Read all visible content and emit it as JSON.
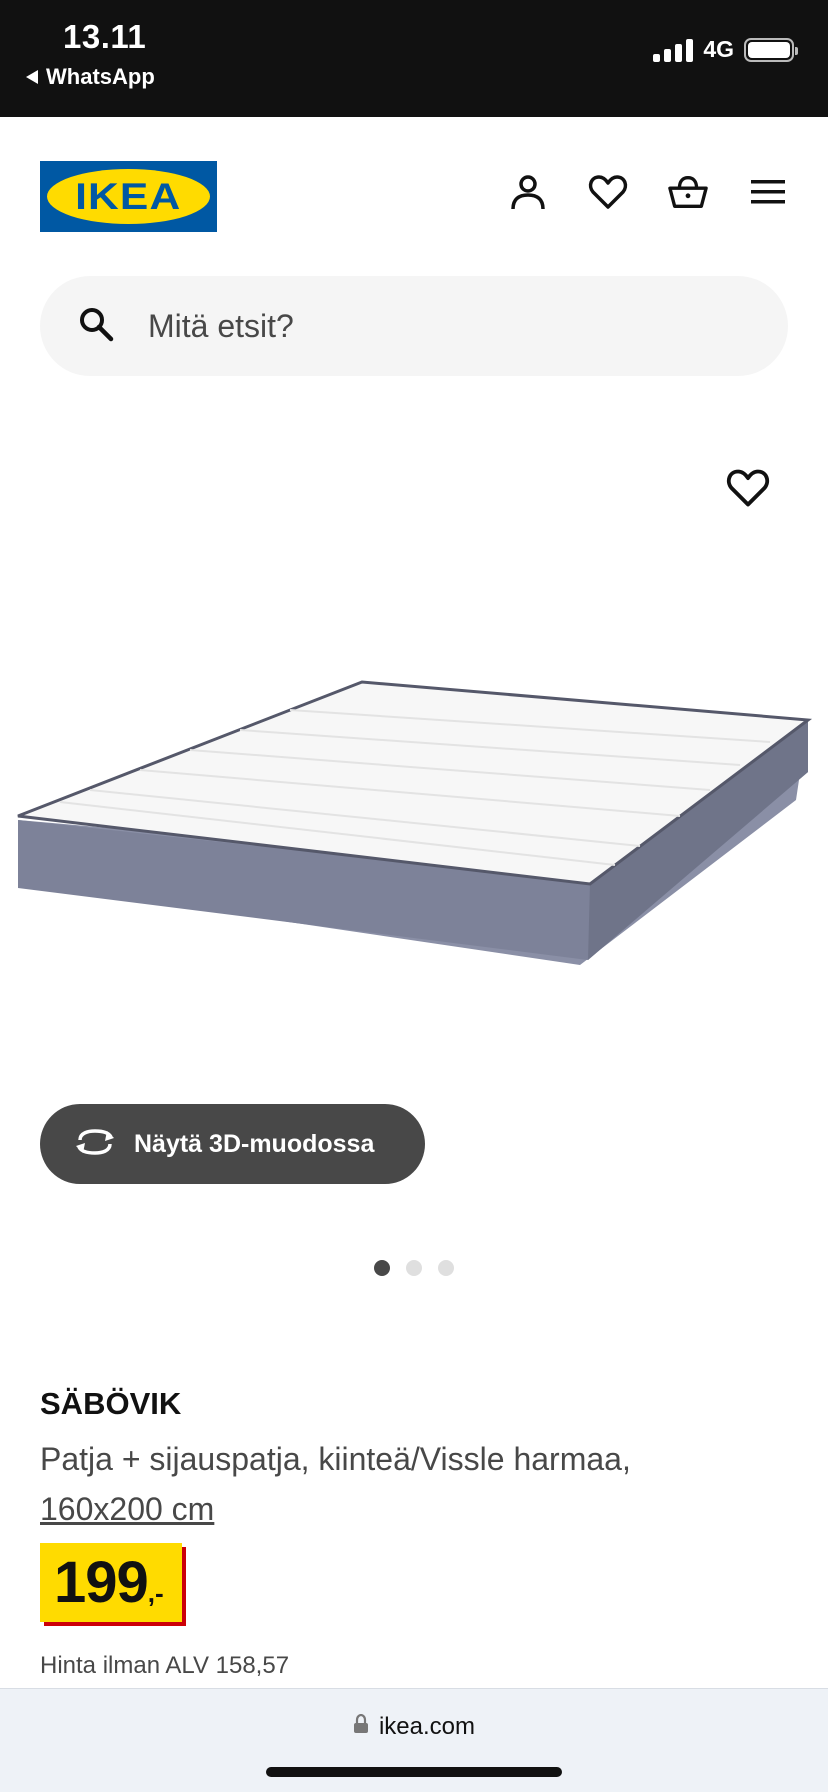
{
  "status_bar": {
    "time": "13.11",
    "back_app": "WhatsApp",
    "network": "4G"
  },
  "header": {
    "logo_text": "IKEA",
    "icons": [
      "user-icon",
      "heart-icon",
      "basket-icon",
      "menu-icon"
    ]
  },
  "search": {
    "placeholder": "Mitä etsit?"
  },
  "gallery": {
    "view_3d_label": "Näytä 3D-muodossa",
    "total_images": 3,
    "active_index": 0
  },
  "product": {
    "name": "SÄBÖVIK",
    "description": "Patja + sijauspatja, kiinteä/Vissle harmaa,",
    "size": "160x200 cm",
    "price": "199",
    "price_suffix": ",-",
    "price_without_vat": "Hinta ilman ALV 158,57"
  },
  "browser": {
    "url": "ikea.com"
  },
  "colors": {
    "ikea_blue": "#0058a3",
    "ikea_yellow": "#ffdb00",
    "price_shadow_red": "#cc0008",
    "button_dark": "#484848"
  }
}
